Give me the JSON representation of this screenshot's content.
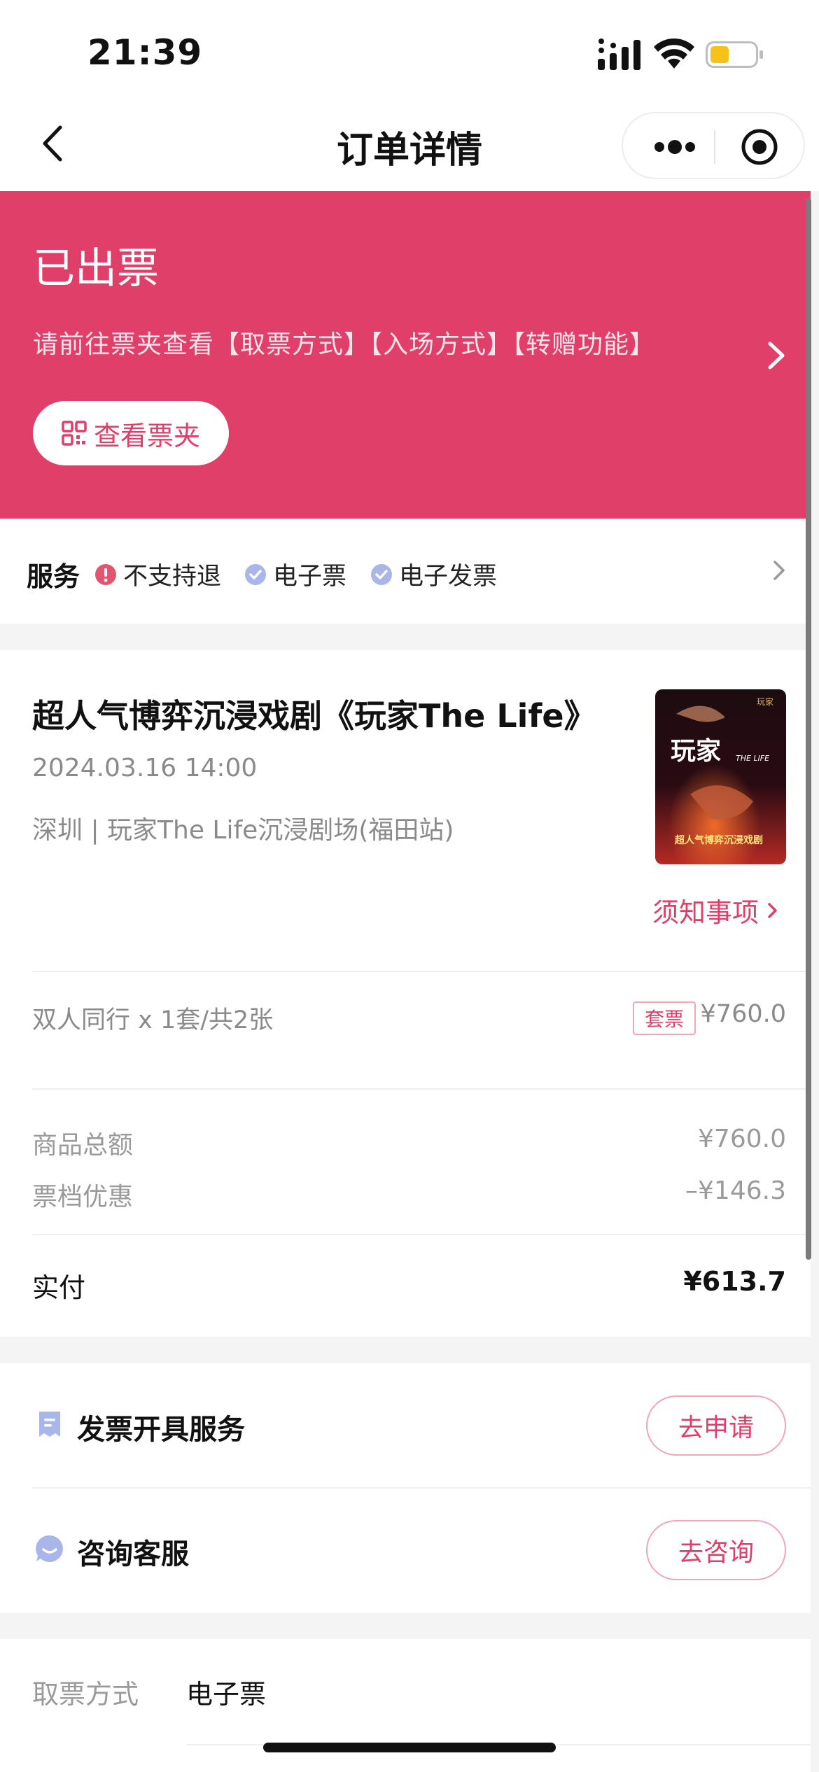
{
  "status_bar": {
    "time": "21:39"
  },
  "nav": {
    "title": "订单详情"
  },
  "banner": {
    "status": "已出票",
    "hint": "请前往票夹查看【取票方式】【入场方式】【转赠功能】",
    "wallet_button": "查看票夹",
    "color": "#df3f69"
  },
  "services": {
    "title": "服务",
    "items": [
      {
        "label": "不支持退",
        "icon": "alert-icon",
        "color": "#e0566f"
      },
      {
        "label": "电子票",
        "icon": "check-icon",
        "color": "#a9b6ea"
      },
      {
        "label": "电子发票",
        "icon": "check-icon",
        "color": "#a9b6ea"
      }
    ]
  },
  "order": {
    "title": "超人气博弈沉浸戏剧《玩家The Life》",
    "datetime": "2024.03.16 14:00",
    "venue": "深圳 | 玩家The Life沉浸剧场(福田站)",
    "notice_link": "须知事项",
    "poster": {
      "title": "玩家",
      "subtitle": "THE LIFE",
      "tagline": "超人气博弈沉浸戏剧"
    },
    "ticket_line": "双人同行 x 1套/共2张",
    "package_tag": "套票",
    "ticket_price": "¥760.0",
    "summary": [
      {
        "label": "商品总额",
        "value": "¥760.0"
      },
      {
        "label": "票档优惠",
        "value": "–¥146.3"
      }
    ],
    "paid_label": "实付",
    "paid_value": "¥613.7"
  },
  "actions": [
    {
      "label": "发票开具服务",
      "button": "去申请",
      "icon": "invoice-icon"
    },
    {
      "label": "咨询客服",
      "button": "去咨询",
      "icon": "chat-icon"
    }
  ],
  "pickup": {
    "label": "取票方式",
    "value": "电子票"
  }
}
